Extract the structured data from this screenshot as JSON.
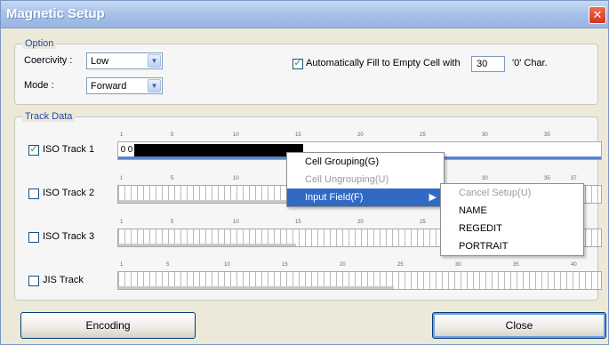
{
  "window": {
    "title": "Magnetic Setup"
  },
  "option": {
    "legend": "Option",
    "coercivity_label": "Coercivity :",
    "coercivity_value": "Low",
    "mode_label": "Mode :",
    "mode_value": "Forward",
    "autofill_label": "Automatically Fill to Empty Cell with",
    "autofill_value": "30",
    "autofill_suffix": "'0'  Char.",
    "autofill_checked": true
  },
  "track_data": {
    "legend": "Track Data",
    "tracks": [
      {
        "label": "ISO Track 1",
        "checked": true,
        "cells": [
          "0",
          "0"
        ],
        "ticks": [
          "1",
          "5",
          "10",
          "15",
          "20",
          "25",
          "30",
          "35"
        ]
      },
      {
        "label": "ISO Track 2",
        "checked": false,
        "ticks": [
          "1",
          "5",
          "10",
          "15",
          "20",
          "25",
          "30",
          "35",
          "37"
        ]
      },
      {
        "label": "ISO Track 3",
        "checked": false,
        "ticks": [
          "1",
          "5",
          "10",
          "15",
          "20",
          "25",
          "30",
          "35"
        ]
      },
      {
        "label": "JIS Track",
        "checked": false,
        "ticks": [
          "1",
          "5",
          "10",
          "15",
          "20",
          "25",
          "30",
          "35",
          "40"
        ]
      }
    ]
  },
  "context_menu": {
    "items": [
      "Cell Grouping(G)",
      "Cell Ungrouping(U)",
      "Input Field(F)"
    ],
    "submenu": [
      "Cancel Setup(U)",
      "NAME",
      "REGEDIT",
      "PORTRAIT"
    ]
  },
  "buttons": {
    "encoding": "Encoding",
    "close": "Close"
  },
  "colors": {
    "accent": "#316ac5",
    "legend": "#1f4aa8",
    "titlebar": "#a9c2e8"
  }
}
